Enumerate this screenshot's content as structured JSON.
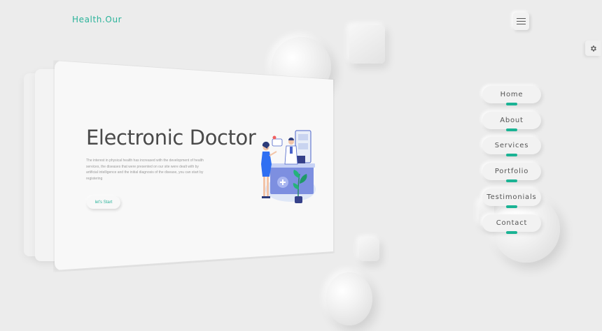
{
  "brand": {
    "name": "Health.Our",
    "color": "#2ab39a"
  },
  "header": {
    "menu_icon": "hamburger-icon"
  },
  "settings": {
    "icon": "gear-icon"
  },
  "hero": {
    "title": "Electronic Doctor",
    "description": "The interest in physical health has increased with the development of health services, the diseases that were presented on our site were dealt with by artificial intelligence and the initial diagnosis of the disease, you can start by registering",
    "cta_label": "let's Start",
    "illustration": "doctor-patient-illustration"
  },
  "nav": {
    "items": [
      {
        "label": "Home"
      },
      {
        "label": "About"
      },
      {
        "label": "Services"
      },
      {
        "label": "Portfolio"
      },
      {
        "label": "Testimonials"
      },
      {
        "label": "Contact"
      }
    ],
    "accent": "#1ab394"
  }
}
